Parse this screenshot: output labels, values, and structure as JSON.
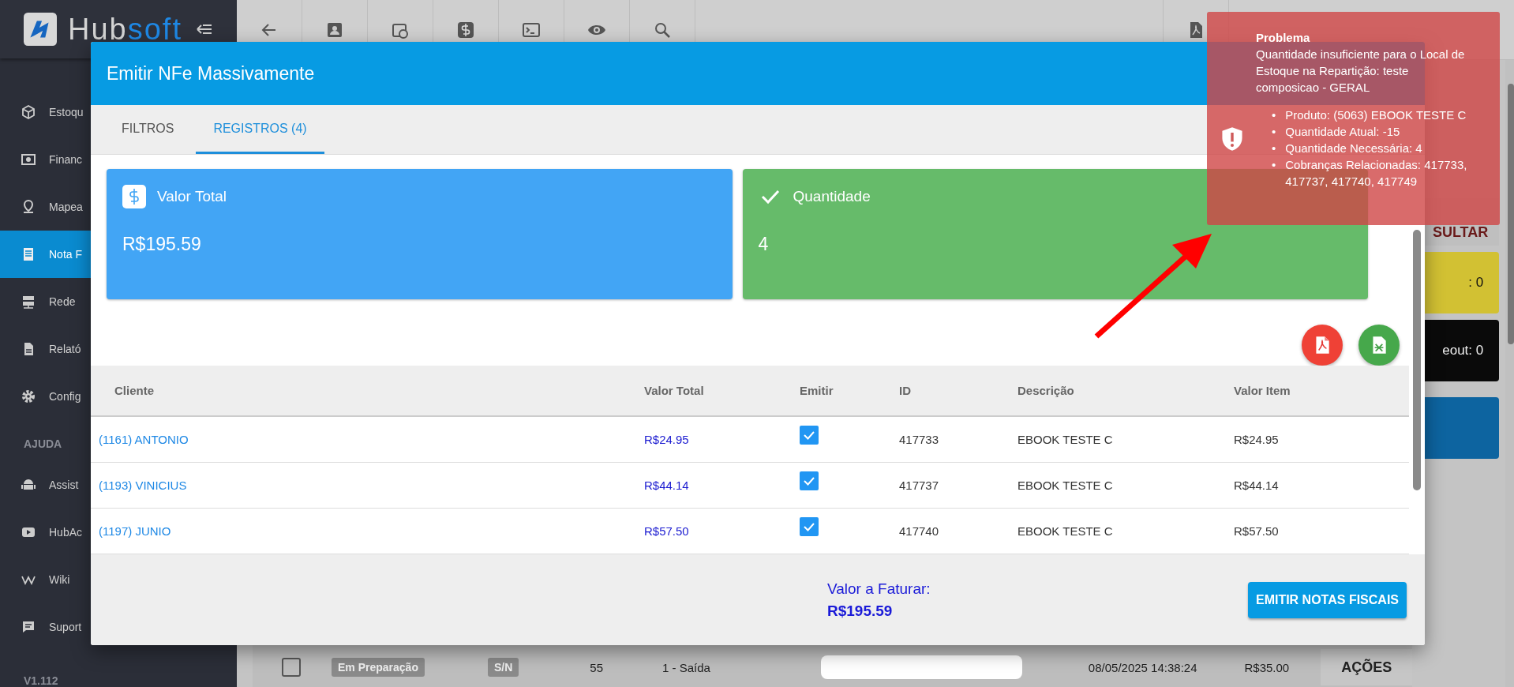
{
  "app": {
    "logo": "Hubsoft",
    "version": "V1.112"
  },
  "sidebar": {
    "items": [
      {
        "kind": "box",
        "label": "Estoqu",
        "selected": false
      },
      {
        "kind": "money",
        "label": "Financ",
        "selected": false
      },
      {
        "kind": "pin",
        "label": "Mapea",
        "selected": false
      },
      {
        "kind": "receipt",
        "label": "Nota F",
        "selected": true
      },
      {
        "kind": "server",
        "label": "Rede",
        "selected": false
      },
      {
        "kind": "document",
        "label": "Relató",
        "selected": false
      },
      {
        "kind": "gear",
        "label": "Config",
        "selected": false
      }
    ],
    "help": {
      "title": "AJUDA",
      "items": [
        {
          "kind": "android",
          "label": "Assist",
          "selected": false
        },
        {
          "kind": "video",
          "label": "HubAc",
          "selected": false
        },
        {
          "kind": "wiki",
          "label": "Wiki",
          "selected": false
        },
        {
          "kind": "chat",
          "label": "Suport",
          "selected": false
        }
      ]
    }
  },
  "background": {
    "search_button": "SULTAR",
    "cards": [
      {
        "kind": "yellow",
        "text": ": 0"
      },
      {
        "kind": "black",
        "text": "eout: 0"
      },
      {
        "kind": "blue"
      }
    ],
    "row": {
      "checked": false,
      "status": "Em Preparação",
      "serie": "S/N",
      "number": "55",
      "type": "1 - Saída",
      "date": "08/05/2025 14:38:24",
      "value": "R$35.00",
      "actions": "AÇÕES"
    }
  },
  "modal": {
    "title": "Emitir NFe Massivamente",
    "tabs": [
      {
        "label": "FILTROS",
        "selected": false
      },
      {
        "label": "REGISTROS (4)",
        "selected": true
      }
    ],
    "cards": [
      {
        "kind": "money",
        "label": "Valor Total",
        "value": "R$195.59"
      },
      {
        "kind": "check",
        "label": "Quantidade",
        "value": "4"
      }
    ],
    "table": {
      "columns": [
        "Cliente",
        "Valor Total",
        "Emitir",
        "ID",
        "Descrição",
        "Valor Item"
      ],
      "rows": [
        {
          "cliente": "(1161) ANTONIO",
          "valor_total": "R$24.95",
          "emitir": true,
          "id": "417733",
          "descricao": "EBOOK TESTE C",
          "valor_item": "R$24.95"
        },
        {
          "cliente": "(1193) VINICIUS",
          "valor_total": "R$44.14",
          "emitir": true,
          "id": "417737",
          "descricao": "EBOOK TESTE C",
          "valor_item": "R$44.14"
        },
        {
          "cliente": "(1197) JUNIO",
          "valor_total": "R$57.50",
          "emitir": true,
          "id": "417740",
          "descricao": "EBOOK TESTE C",
          "valor_item": "R$57.50"
        }
      ]
    },
    "footer": {
      "label": "Valor a Faturar:",
      "value": "R$195.59",
      "button": "EMITIR NOTAS FISCAIS"
    }
  },
  "toast": {
    "title": "Problema",
    "bullet": "•",
    "message": "Quantidade insuficiente para o Local de Estoque na Repartição: teste composicao - GERAL",
    "details": [
      "Produto: (5063) EBOOK TESTE C",
      "Quantidade Atual: -15",
      "Quantidade Necessária: 4",
      "Cobranças Relacionadas: 417733, 417737, 417740, 417749"
    ]
  }
}
